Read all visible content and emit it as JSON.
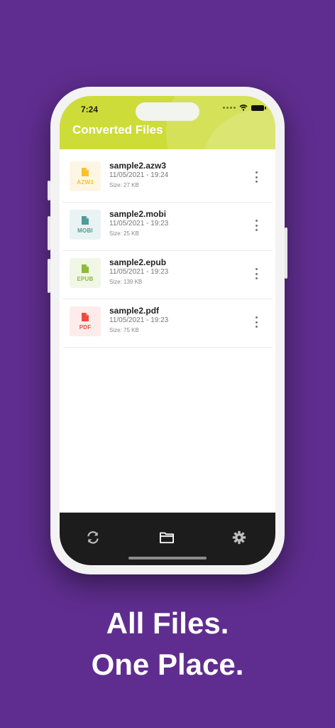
{
  "status_bar": {
    "time": "7:24"
  },
  "header": {
    "title": "Converted Files"
  },
  "files": [
    {
      "name": "sample2.azw3",
      "date": "11/05/2021 - 19:24",
      "size": "Size: 27 KB",
      "ext": "AZW3",
      "color": "#f9c12d",
      "bg": "#fef6e4",
      "icon": "file-icon"
    },
    {
      "name": "sample2.mobi",
      "date": "11/05/2021 - 19:23",
      "size": "Size: 25 KB",
      "ext": "MOBI",
      "color": "#4f9a9a",
      "bg": "#eaf3f3",
      "icon": "file-icon"
    },
    {
      "name": "sample2.epub",
      "date": "11/05/2021 - 19:23",
      "size": "Size: 139 KB",
      "ext": "EPUB",
      "color": "#8dbb35",
      "bg": "#f1f6e7",
      "icon": "file-icon"
    },
    {
      "name": "sample2.pdf",
      "date": "11/05/2021 - 19:23",
      "size": "Size: 75 KB",
      "ext": "PDF",
      "color": "#ec4b42",
      "bg": "#fdeceb",
      "icon": "file-icon"
    }
  ],
  "tabbar": {
    "tabs": [
      {
        "icon": "refresh-icon"
      },
      {
        "icon": "folder-icon"
      },
      {
        "icon": "gear-icon"
      }
    ]
  },
  "tagline": {
    "line1": "All Files.",
    "line2": "One Place."
  },
  "colors": {
    "background": "#5f2d8f",
    "header": "#cddc39",
    "tabbar": "#1c1c1c"
  }
}
